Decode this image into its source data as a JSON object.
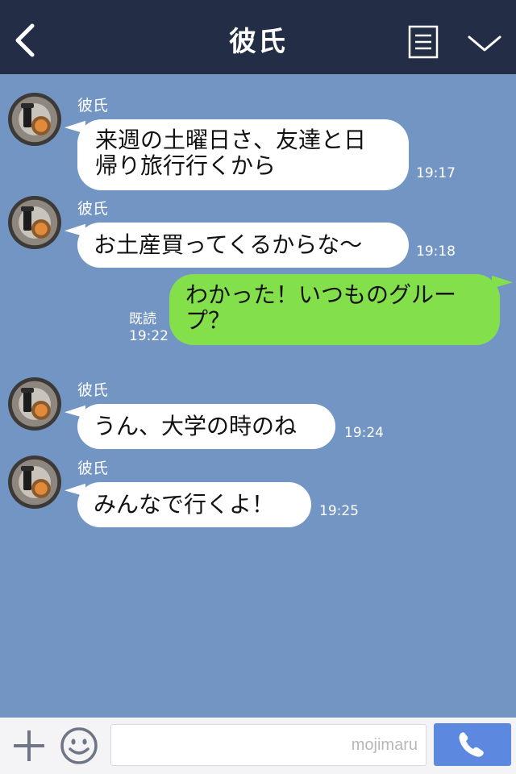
{
  "header": {
    "title": "彼氏",
    "back_icon": "chevron-left-icon",
    "menu_icon": "document-icon",
    "collapse_icon": "chevron-down-icon"
  },
  "messages": [
    {
      "sender": "彼氏",
      "text_lines": [
        "来週の土曜日さ、友達と日",
        "帰り旅行行くから"
      ],
      "time": "19:17"
    },
    {
      "sender": "彼氏",
      "text": "お土産買ってくるからな〜",
      "time": "19:18"
    },
    {
      "text_lines": [
        "わかった！いつものグルー",
        "プ？"
      ],
      "read": "既読",
      "time": "19:22"
    },
    {
      "sender": "彼氏",
      "text": "うん、大学の時のね",
      "time": "19:24"
    },
    {
      "sender": "彼氏",
      "text": "みんなで行くよ！",
      "time": "19:25"
    }
  ],
  "composer": {
    "placeholder": "mojimaru",
    "plus_icon": "plus-icon",
    "sticker_icon": "smiley-icon",
    "call_icon": "phone-icon"
  },
  "colors": {
    "header_bg": "#232d45",
    "chat_bg": "#7395c4",
    "incoming_bubble": "#ffffff",
    "outgoing_bubble": "#84e04a",
    "call_button": "#5c88e0"
  }
}
